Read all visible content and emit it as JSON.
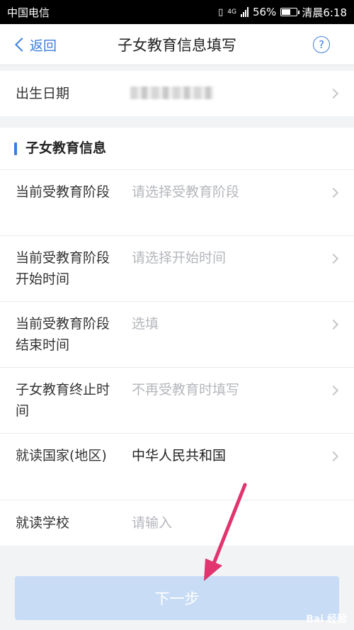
{
  "status_bar": {
    "carrier": "中国电信",
    "network": "4G",
    "battery": "56%",
    "time": "清晨6:18"
  },
  "nav": {
    "back_label": "返回",
    "title": "子女教育信息填写",
    "help_symbol": "?"
  },
  "birth_row": {
    "label": "出生日期"
  },
  "section": {
    "title": "子女教育信息"
  },
  "rows": [
    {
      "label": "当前受教育阶段",
      "value": "请选择受教育阶段",
      "is_placeholder": true
    },
    {
      "label": "当前受教育阶段开始时间",
      "value": "请选择开始时间",
      "is_placeholder": true
    },
    {
      "label": "当前受教育阶段结束时间",
      "value": "选填",
      "is_placeholder": true
    },
    {
      "label": "子女教育终止时间",
      "value": "不再受教育时填写",
      "is_placeholder": true
    },
    {
      "label": "就读国家(地区)",
      "value": "中华人民共和国",
      "is_placeholder": false
    },
    {
      "label": "就读学校",
      "placeholder": "请输入",
      "is_placeholder": true
    }
  ],
  "next_button": {
    "label": "下一步"
  },
  "watermark": "Bai 经验",
  "colors": {
    "accent": "#3b7ddd",
    "placeholder": "#b5b7bc",
    "button_disabled": "#c8dcf6",
    "annotation_arrow": "#e0356e"
  }
}
